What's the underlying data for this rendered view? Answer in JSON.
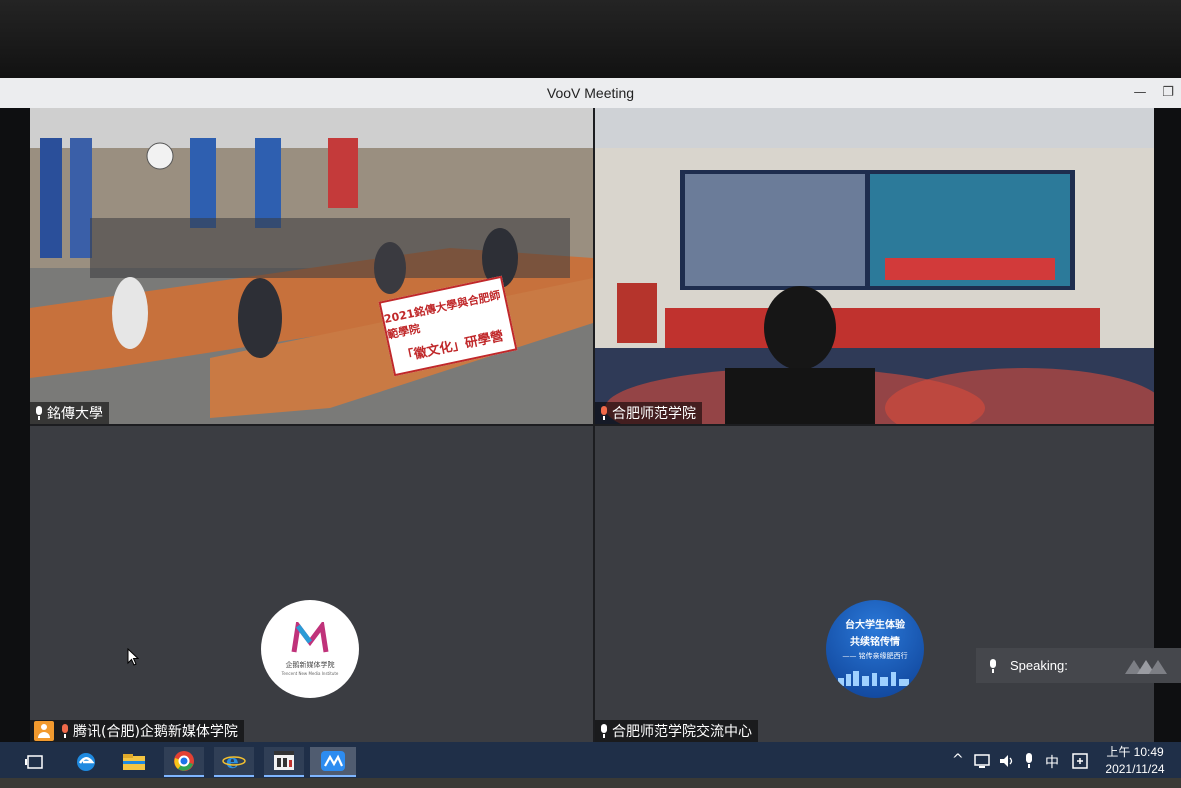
{
  "window": {
    "title": "VooV Meeting",
    "minimize_glyph": "—",
    "maximize_glyph": "❐"
  },
  "tiles": [
    {
      "name": "銘傳大學",
      "mic": "mic-icon",
      "type": "video"
    },
    {
      "name": "合肥师范学院",
      "mic": "mic-active-icon",
      "type": "video"
    },
    {
      "name": "腾讯(合肥)企鹅新媒体学院",
      "mic": "mic-active-icon",
      "type": "avatar",
      "avatar_caption": "企鹅新媒体学院",
      "avatar_sub": "Tencent New Media Institute"
    },
    {
      "name": "合肥师范学院交流中心",
      "mic": "mic-icon",
      "type": "avatar",
      "avatar_line1": "台大学生体验",
      "avatar_line2": "共续铭传情",
      "avatar_line3": "—— 铭传亲缘肥西行"
    }
  ],
  "video_banner": {
    "line1": "2021銘傳大學與合肥師範學院",
    "line2": "「徽文化」研學營"
  },
  "speaking": {
    "label": "Speaking:"
  },
  "taskbar": {
    "apps": [
      "task-view-icon",
      "edge-icon",
      "file-explorer-icon",
      "chrome-icon",
      "ie-icon",
      "video-app-icon",
      "voov-icon"
    ],
    "tray": {
      "chevron": "^",
      "volume": "🔊",
      "ime": "中"
    },
    "clock": {
      "time": "上午 10:49",
      "date": "2021/11/24"
    }
  },
  "colors": {
    "accent": "#f29a2e",
    "mic_active": "#f06a4a",
    "taskbar": "#1f2f48"
  }
}
